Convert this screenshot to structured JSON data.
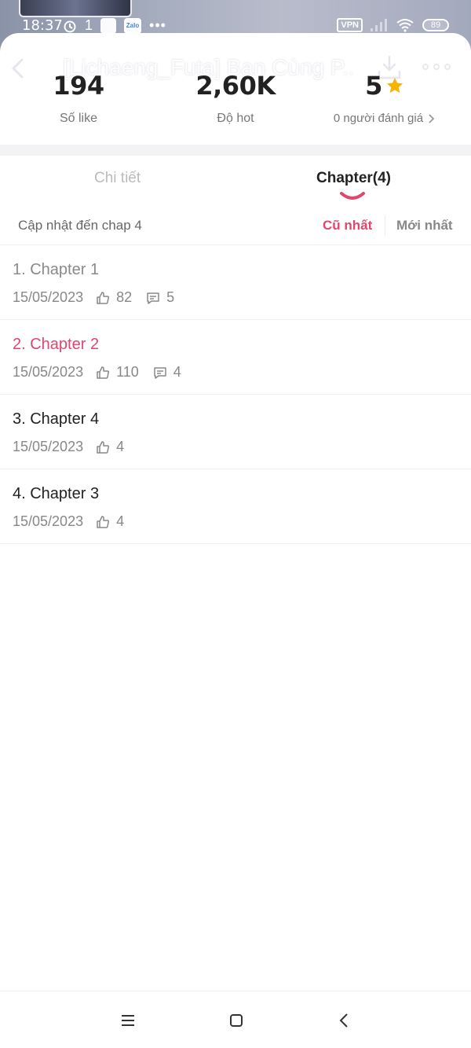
{
  "status_bar": {
    "time": "18:37",
    "notification_badge": "1",
    "zalo_label": "Zalo",
    "vpn_label": "VPN",
    "battery": "89"
  },
  "nav": {
    "title": "[Lichaeng_Futa] Ban Cùng P..."
  },
  "stats": {
    "likes_value": "194",
    "likes_label": "Số like",
    "hot_value": "2,60K",
    "hot_label": "Độ hot",
    "rating_value": "5",
    "rating_label": "0 người đánh giá"
  },
  "tabs": {
    "detail": "Chi tiết",
    "chapter": "Chapter(4)"
  },
  "sort": {
    "update_text": "Cập nhật đến chap 4",
    "oldest": "Cũ nhất",
    "newest": "Mới nhất"
  },
  "chapters": [
    {
      "title": "1. Chapter 1",
      "date": "15/05/2023",
      "likes": "82",
      "comments": "5",
      "state": "read"
    },
    {
      "title": "2. Chapter 2",
      "date": "15/05/2023",
      "likes": "110",
      "comments": "4",
      "state": "current"
    },
    {
      "title": "3. Chapter 4",
      "date": "15/05/2023",
      "likes": "4",
      "comments": "",
      "state": "unread"
    },
    {
      "title": "4. Chapter 3",
      "date": "15/05/2023",
      "likes": "4",
      "comments": "",
      "state": "unread"
    }
  ],
  "colors": {
    "accent": "#e0466e",
    "star": "#f5b400"
  }
}
